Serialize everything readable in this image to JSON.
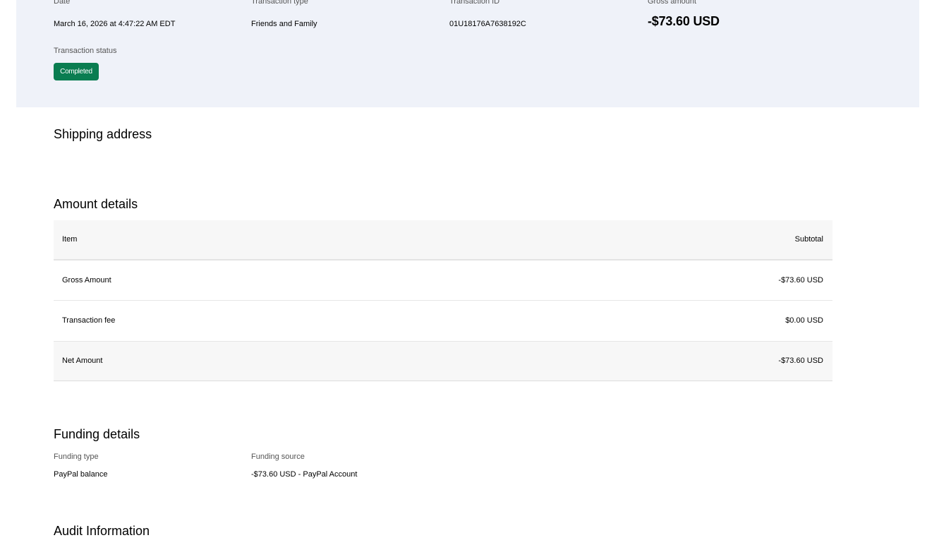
{
  "summary": {
    "date_label": "Date",
    "date_value": "March 16, 2026 at 4:47:22 AM EDT",
    "type_label": "Transaction type",
    "type_value": "Friends and Family",
    "id_label": "Transaction ID",
    "id_value": "01U18176A7638192C",
    "gross_label": "Gross amount",
    "gross_value": "-$73.60 USD",
    "status_label": "Transaction status",
    "status_value": "Completed",
    "status_color": "#0a7d51",
    "band_color": "#eff2f9"
  },
  "shipping": {
    "title": "Shipping address"
  },
  "amount_details": {
    "title": "Amount details",
    "header": {
      "item": "Item",
      "subtotal": "Subtotal"
    },
    "rows": [
      {
        "item": "Gross Amount",
        "subtotal": "-$73.60 USD"
      },
      {
        "item": "Transaction fee",
        "subtotal": "$0.00 USD"
      },
      {
        "item": "Net Amount",
        "subtotal": "-$73.60 USD"
      }
    ]
  },
  "funding": {
    "title": "Funding details",
    "type_label": "Funding type",
    "type_value": "PayPal balance",
    "source_label": "Funding source",
    "source_value": "-$73.60 USD - PayPal Account"
  },
  "audit": {
    "title": "Audit Information"
  }
}
